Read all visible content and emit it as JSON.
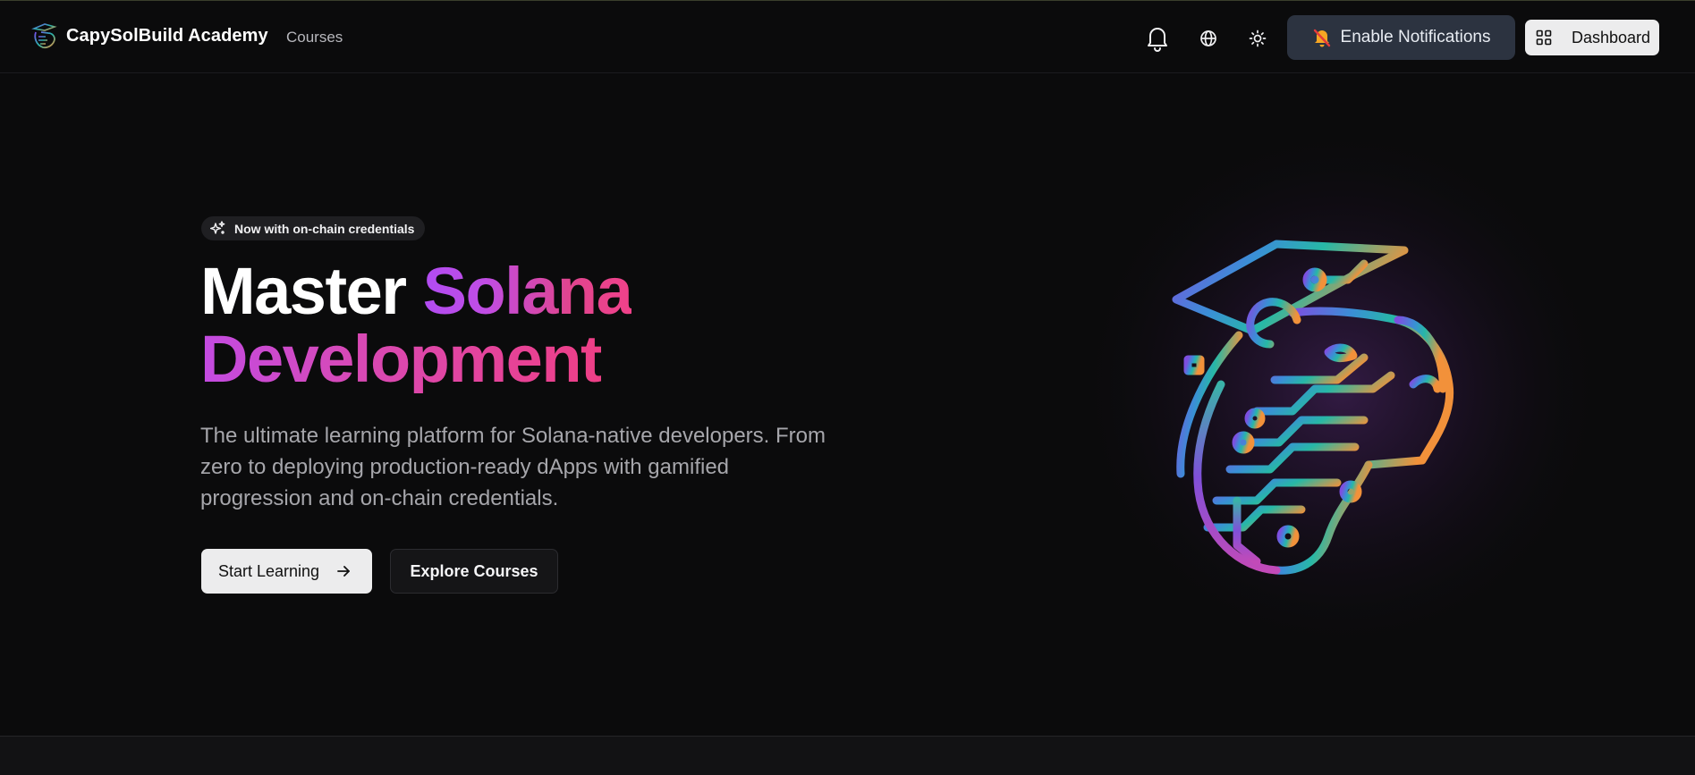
{
  "app": {
    "brand_name": "CapySolBuild Academy"
  },
  "nav": {
    "courses_label": "Courses"
  },
  "header_actions": {
    "notifications_icon": "bell-icon",
    "language_icon": "globe-icon",
    "theme_icon": "sun-icon",
    "enable_notifications_label": "Enable Notifications",
    "enable_notifications_icon": "bell-slash-icon",
    "dashboard_label": "Dashboard",
    "dashboard_icon": "grid-icon"
  },
  "hero": {
    "badge_label": "Now with on-chain credentials",
    "badge_icon": "sparkles-icon",
    "headline_part1": "Master",
    "headline_part2": "Solana",
    "headline_line2": "Development",
    "subtext": "The ultimate learning platform for Solana-native developers. From zero to deploying production-ready dApps with gamified progression and on-chain credentials.",
    "primary_cta_label": "Start Learning",
    "primary_cta_icon": "arrow-right-icon",
    "secondary_cta_label": "Explore Courses",
    "illustration": "capybara-graduation-circuit-logo"
  },
  "colors": {
    "background": "#0b0b0c",
    "accent_purple": "#b14cf2",
    "accent_pink": "#ee3f86",
    "accent_teal": "#27b8a6",
    "accent_orange": "#f2913a",
    "notify_button_bg": "#2c3340"
  }
}
